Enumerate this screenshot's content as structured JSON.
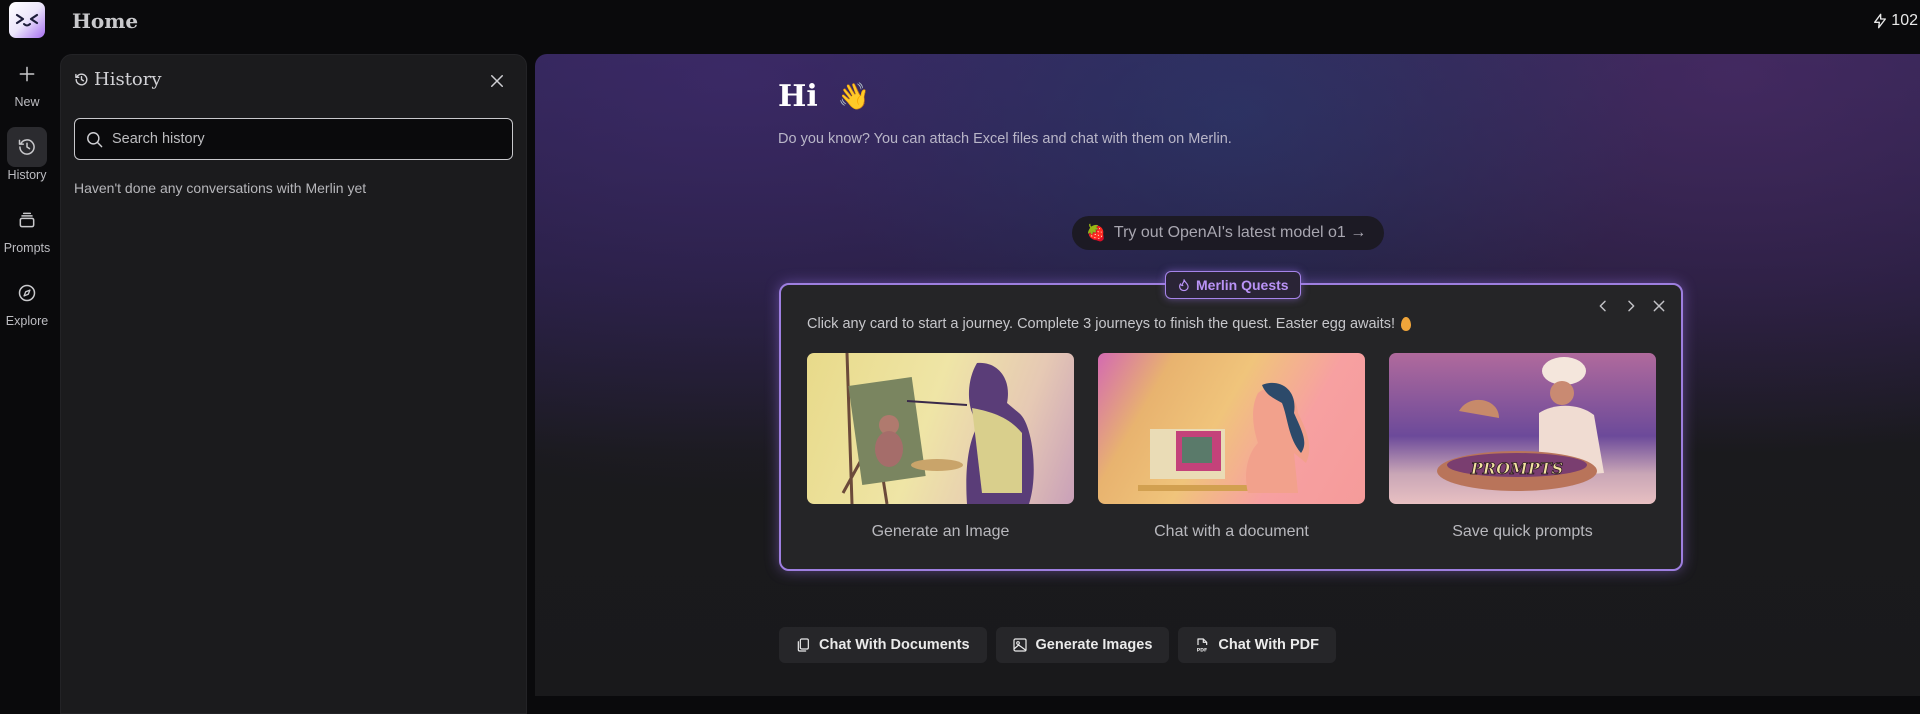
{
  "header": {
    "title": "Home",
    "credits": "102"
  },
  "rail": {
    "items": [
      {
        "label": "New",
        "icon": "plus-icon"
      },
      {
        "label": "History",
        "icon": "history-icon",
        "active": true
      },
      {
        "label": "Prompts",
        "icon": "prompts-icon"
      },
      {
        "label": "Explore",
        "icon": "compass-icon"
      }
    ]
  },
  "history": {
    "title": "History",
    "search_placeholder": "Search history",
    "search_value": "",
    "empty_text": "Haven't done any conversations with Merlin yet"
  },
  "main": {
    "greeting": "Hi",
    "greeting_emoji": "👋",
    "tip": "Do you know? You can attach Excel files and chat with them on Merlin.",
    "promo": {
      "emoji": "🍓",
      "label": "Try out OpenAI's latest model o1 →"
    },
    "quest": {
      "badge": "Merlin Quests",
      "description": "Click any card to start a journey. Complete 3 journeys to finish the quest. Easter egg awaits!",
      "cards": [
        {
          "label": "Generate an Image",
          "image": "painter-with-teddy-bear"
        },
        {
          "label": "Chat with a document",
          "image": "woman-at-retro-computer"
        },
        {
          "label": "Save quick prompts",
          "image": "chef-with-prompts-bowl",
          "image_text": "PROMPTS"
        }
      ]
    },
    "actions": [
      {
        "label": "Chat With Documents",
        "icon": "documents-icon"
      },
      {
        "label": "Generate Images",
        "icon": "image-icon"
      },
      {
        "label": "Chat With PDF",
        "icon": "pdf-icon"
      }
    ]
  },
  "colors": {
    "accent": "#9e7fe0",
    "badge_text": "#b993f6"
  }
}
